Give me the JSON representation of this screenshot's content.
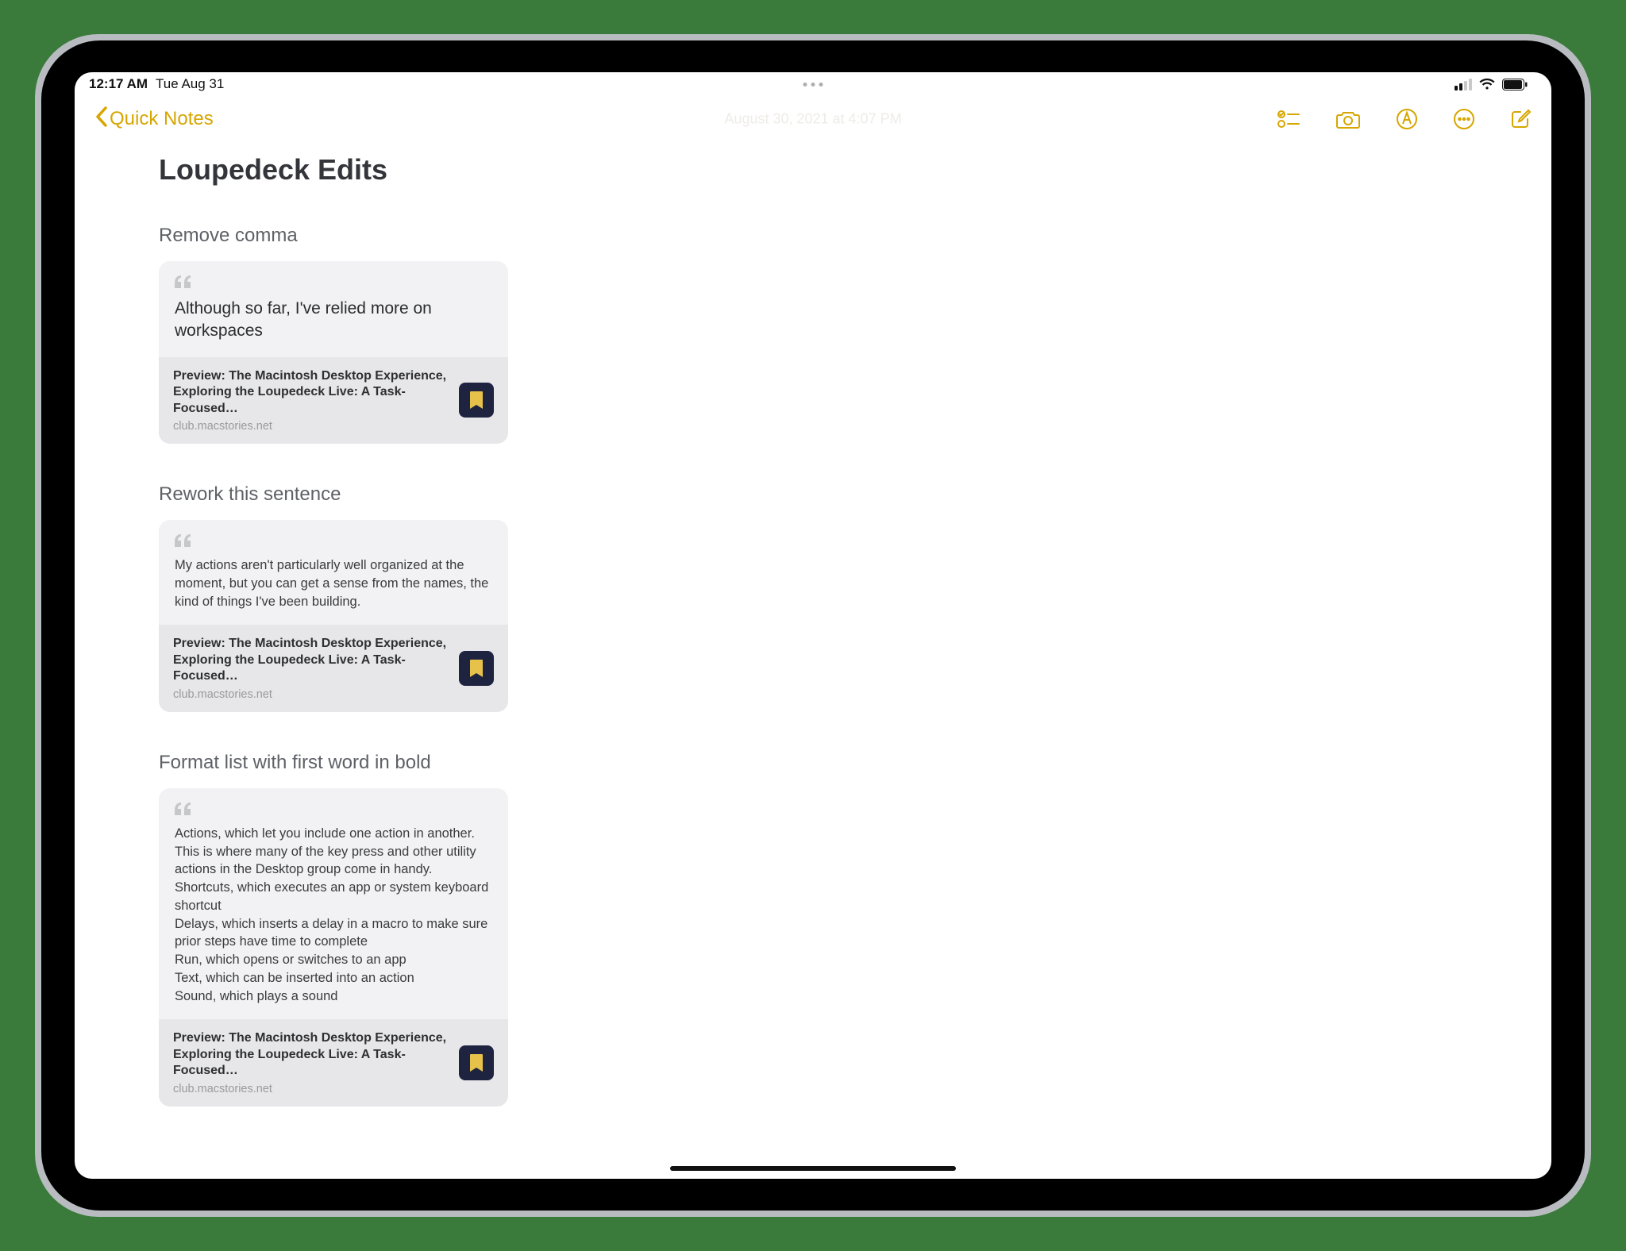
{
  "status": {
    "time": "12:17 AM",
    "date": "Tue Aug 31"
  },
  "nav": {
    "back_label": "Quick Notes",
    "center_text": "August 30, 2021 at 4:07 PM"
  },
  "note": {
    "title": "Loupedeck Edits",
    "sections": [
      {
        "heading": "Remove comma",
        "quote": "Although so far, I've relied more on workspaces",
        "quote_style": "large",
        "link_title": "Preview: The Macintosh Desktop Experience, Exploring the Loupedeck Live: A Task-Focused…",
        "link_domain": "club.macstories.net"
      },
      {
        "heading": "Rework this sentence",
        "quote": "My actions aren't particularly well organized at the moment, but you can get a sense from the names, the kind of things I've been building.",
        "quote_style": "small",
        "link_title": "Preview: The Macintosh Desktop Experience, Exploring the Loupedeck Live: A Task-Focused…",
        "link_domain": "club.macstories.net"
      },
      {
        "heading": "Format list with first word in bold",
        "quote": "Actions, which let you include one action in another. This is where many of the key press and other utility actions in the Desktop group come in handy.\nShortcuts, which executes an app or system keyboard shortcut\nDelays, which inserts a delay in a macro to make sure prior steps have time to complete\nRun, which opens or switches to an app\nText, which can be inserted into an action\nSound, which plays a sound",
        "quote_style": "small",
        "link_title": "Preview: The Macintosh Desktop Experience, Exploring the Loupedeck Live: A Task-Focused…",
        "link_domain": "club.macstories.net"
      }
    ]
  },
  "icons": {
    "checklist": "checklist-icon",
    "camera": "camera-icon",
    "markup": "markup-icon",
    "more": "more-icon",
    "compose": "compose-icon",
    "bookmark": "bookmark-icon"
  }
}
